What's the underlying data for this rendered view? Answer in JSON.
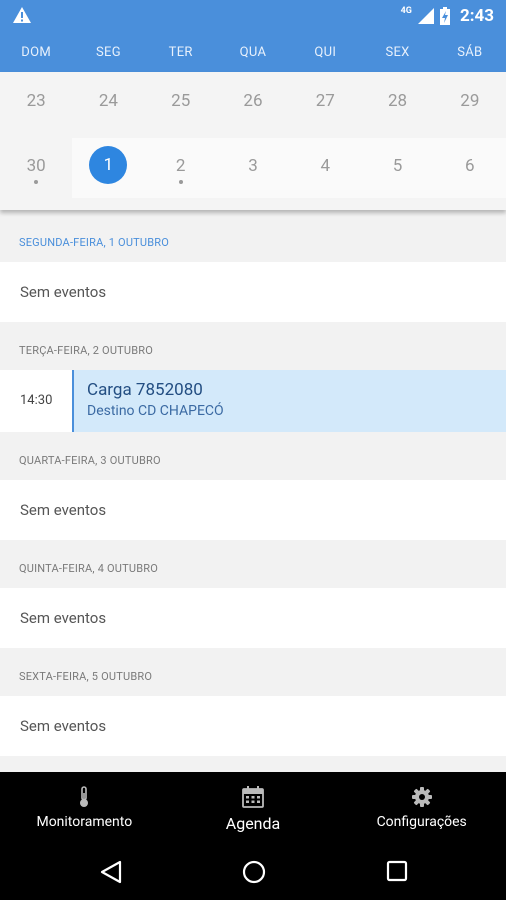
{
  "status_bar": {
    "network_type": "4G",
    "time": "2:43"
  },
  "weekdays": [
    "DOM",
    "SEG",
    "TER",
    "QUA",
    "QUI",
    "SEX",
    "SÁB"
  ],
  "calendar": {
    "week1": [
      "23",
      "24",
      "25",
      "26",
      "27",
      "28",
      "29"
    ],
    "week2": [
      "30",
      "1",
      "2",
      "3",
      "4",
      "5",
      "6"
    ],
    "selected_day": "1"
  },
  "agenda": {
    "days": [
      {
        "header": "SEGUNDA-FEIRA, 1 OUTUBRO",
        "empty_text": "Sem eventos"
      },
      {
        "header": "TERÇA-FEIRA, 2 OUTUBRO",
        "event": {
          "time": "14:30",
          "title": "Carga 7852080",
          "subtitle": "Destino CD CHAPECÓ"
        }
      },
      {
        "header": "QUARTA-FEIRA, 3 OUTUBRO",
        "empty_text": "Sem eventos"
      },
      {
        "header": "QUINTA-FEIRA, 4 OUTUBRO",
        "empty_text": "Sem eventos"
      },
      {
        "header": "SEXTA-FEIRA, 5 OUTUBRO",
        "empty_text": "Sem eventos"
      }
    ]
  },
  "bottom_nav": {
    "items": [
      {
        "label": "Monitoramento",
        "icon": "thermometer-icon"
      },
      {
        "label": "Agenda",
        "icon": "calendar-icon"
      },
      {
        "label": "Configurações",
        "icon": "gear-icon"
      }
    ],
    "active": "Agenda"
  },
  "colors": {
    "primary": "#4a8fdb",
    "selected_day": "#2e86e0",
    "event_background": "#d3e9fa"
  }
}
